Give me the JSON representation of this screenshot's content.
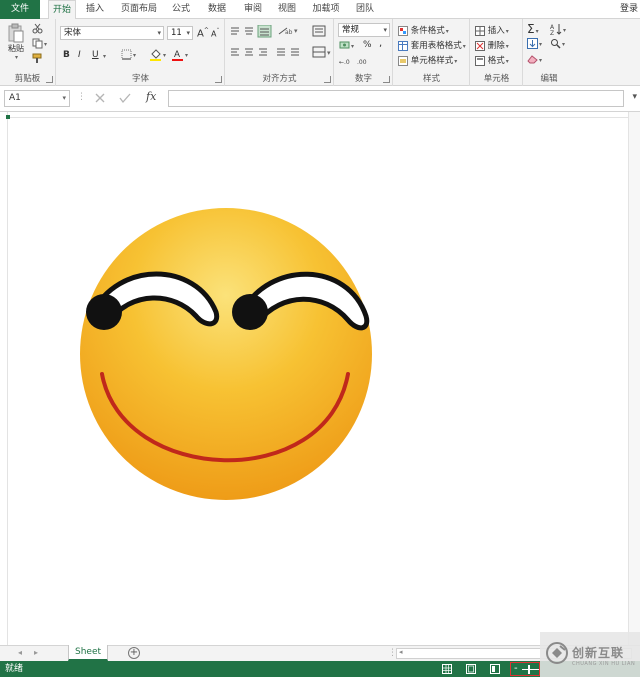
{
  "tabs": {
    "file": "文件",
    "home": "开始",
    "insert": "插入",
    "page_layout": "页面布局",
    "formulas": "公式",
    "data": "数据",
    "review": "审阅",
    "view": "视图",
    "addins": "加载项",
    "team": "团队",
    "login": "登录"
  },
  "ribbon": {
    "clipboard": {
      "paste": "粘贴",
      "label": "剪贴板"
    },
    "font": {
      "name": "宋体",
      "size": "11",
      "grow": "A",
      "shrink": "A",
      "bold": "B",
      "italic": "I",
      "underline": "U",
      "label": "字体"
    },
    "alignment": {
      "label": "对齐方式"
    },
    "number": {
      "format": "常规",
      "percent": "%",
      "comma": ",",
      "label": "数字"
    },
    "styles": {
      "conditional": "条件格式",
      "table": "套用表格格式",
      "cell": "单元格样式",
      "label": "样式"
    },
    "cells": {
      "insert": "插入",
      "delete": "删除",
      "format": "格式",
      "label": "单元格"
    },
    "editing": {
      "label": "编辑"
    }
  },
  "formula_bar": {
    "name_box": "A1",
    "fx": "fx",
    "value": ""
  },
  "sheet": {
    "tab_name": "Sheet",
    "add": "+"
  },
  "status": {
    "ready": "就绪"
  },
  "watermark": {
    "name": "创新互联",
    "sub": "CHUANG XIN HU LIAN"
  },
  "colors": {
    "excel_green": "#217346",
    "ribbon_bg": "#f3f3f3",
    "smiley_yellow": "#f7c233",
    "smiley_orange": "#f0a21f",
    "mouth_red": "#c0281b"
  }
}
